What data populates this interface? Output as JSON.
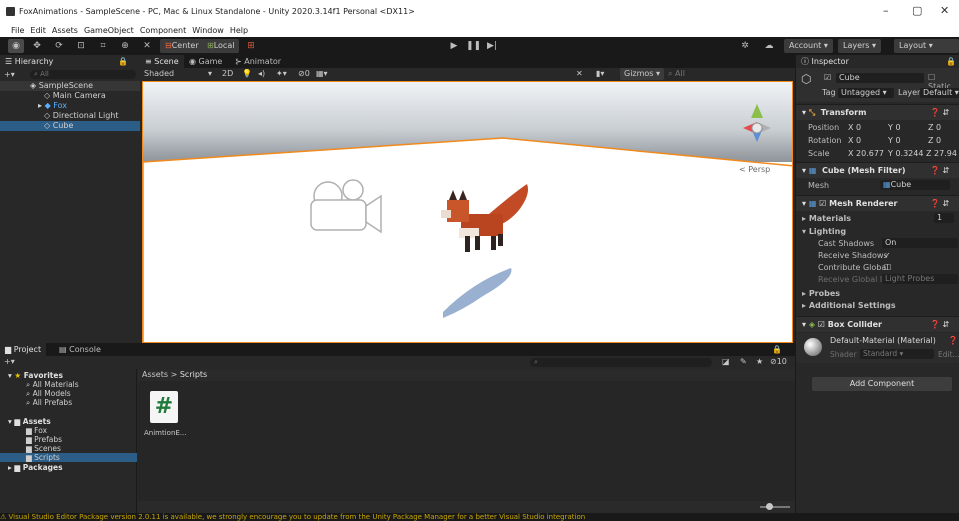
{
  "window": {
    "title": "FoxAnimations - SampleScene - PC, Mac & Linux Standalone - Unity 2020.3.14f1 Personal <DX11>",
    "min_glyph": "–",
    "max_glyph": "▢",
    "close_glyph": "✕"
  },
  "menu": [
    "File",
    "Edit",
    "Assets",
    "GameObject",
    "Component",
    "Window",
    "Help"
  ],
  "toolbar": {
    "center_label": "Center",
    "local_label": "Local",
    "account_label": "Account",
    "layers_label": "Layers",
    "layout_label": "Layout"
  },
  "hierarchy": {
    "tab": "Hierarchy",
    "search_placeholder": "All",
    "scene_name": "SampleScene",
    "items": [
      "Main Camera",
      "Fox",
      "Directional Light",
      "Cube"
    ]
  },
  "scene": {
    "tabs": [
      "Scene",
      "Game",
      "Animator"
    ],
    "shading": "Shaded",
    "mode_2d": "2D",
    "gizmos": "Gizmos",
    "search_placeholder": "All",
    "persp_label": "Persp",
    "count_label": "0"
  },
  "project": {
    "tabs": [
      "Project",
      "Console"
    ],
    "favorites_label": "Favorites",
    "favorites": [
      "All Materials",
      "All Models",
      "All Prefabs"
    ],
    "assets_label": "Assets",
    "folders": [
      "Fox",
      "Prefabs",
      "Scenes",
      "Scripts"
    ],
    "packages_label": "Packages",
    "breadcrumb_root": "Assets",
    "breadcrumb_sep": ">",
    "breadcrumb_current": "Scripts",
    "file_name": "AnimtionE...",
    "slider_count": "10"
  },
  "inspector": {
    "tab": "Inspector",
    "object_name": "Cube",
    "static_label": "Static",
    "tag_label": "Tag",
    "tag_value": "Untagged",
    "layer_label": "Layer",
    "layer_value": "Default",
    "transform": {
      "title": "Transform",
      "position_label": "Position",
      "rotation_label": "Rotation",
      "scale_label": "Scale",
      "pos": [
        "0",
        "0",
        "0"
      ],
      "rot": [
        "0",
        "0",
        "0"
      ],
      "scale": [
        "20.677",
        "0.3244",
        "27.94"
      ]
    },
    "mesh_filter": {
      "title": "Cube (Mesh Filter)",
      "mesh_label": "Mesh",
      "mesh_value": "Cube"
    },
    "mesh_renderer": {
      "title": "Mesh Renderer",
      "materials_label": "Materials",
      "materials_count": "1",
      "lighting_label": "Lighting",
      "cast_shadows_label": "Cast Shadows",
      "cast_shadows_value": "On",
      "receive_shadows_label": "Receive Shadows",
      "contribute_gi_label": "Contribute Global",
      "receive_gi_label": "Receive Global Illu",
      "receive_gi_value": "Light Probes",
      "probes_label": "Probes",
      "additional_label": "Additional Settings"
    },
    "box_collider": {
      "title": "Box Collider"
    },
    "material": {
      "name": "Default-Material (Material)",
      "shader_label": "Shader",
      "shader_value": "Standard",
      "edit_label": "Edit..."
    },
    "add_component": "Add Component"
  },
  "status": {
    "message": "Visual Studio Editor Package version 2.0.11 is available, we strongly encourage you to update from the Unity Package Manager for a better Visual Studio integration"
  }
}
